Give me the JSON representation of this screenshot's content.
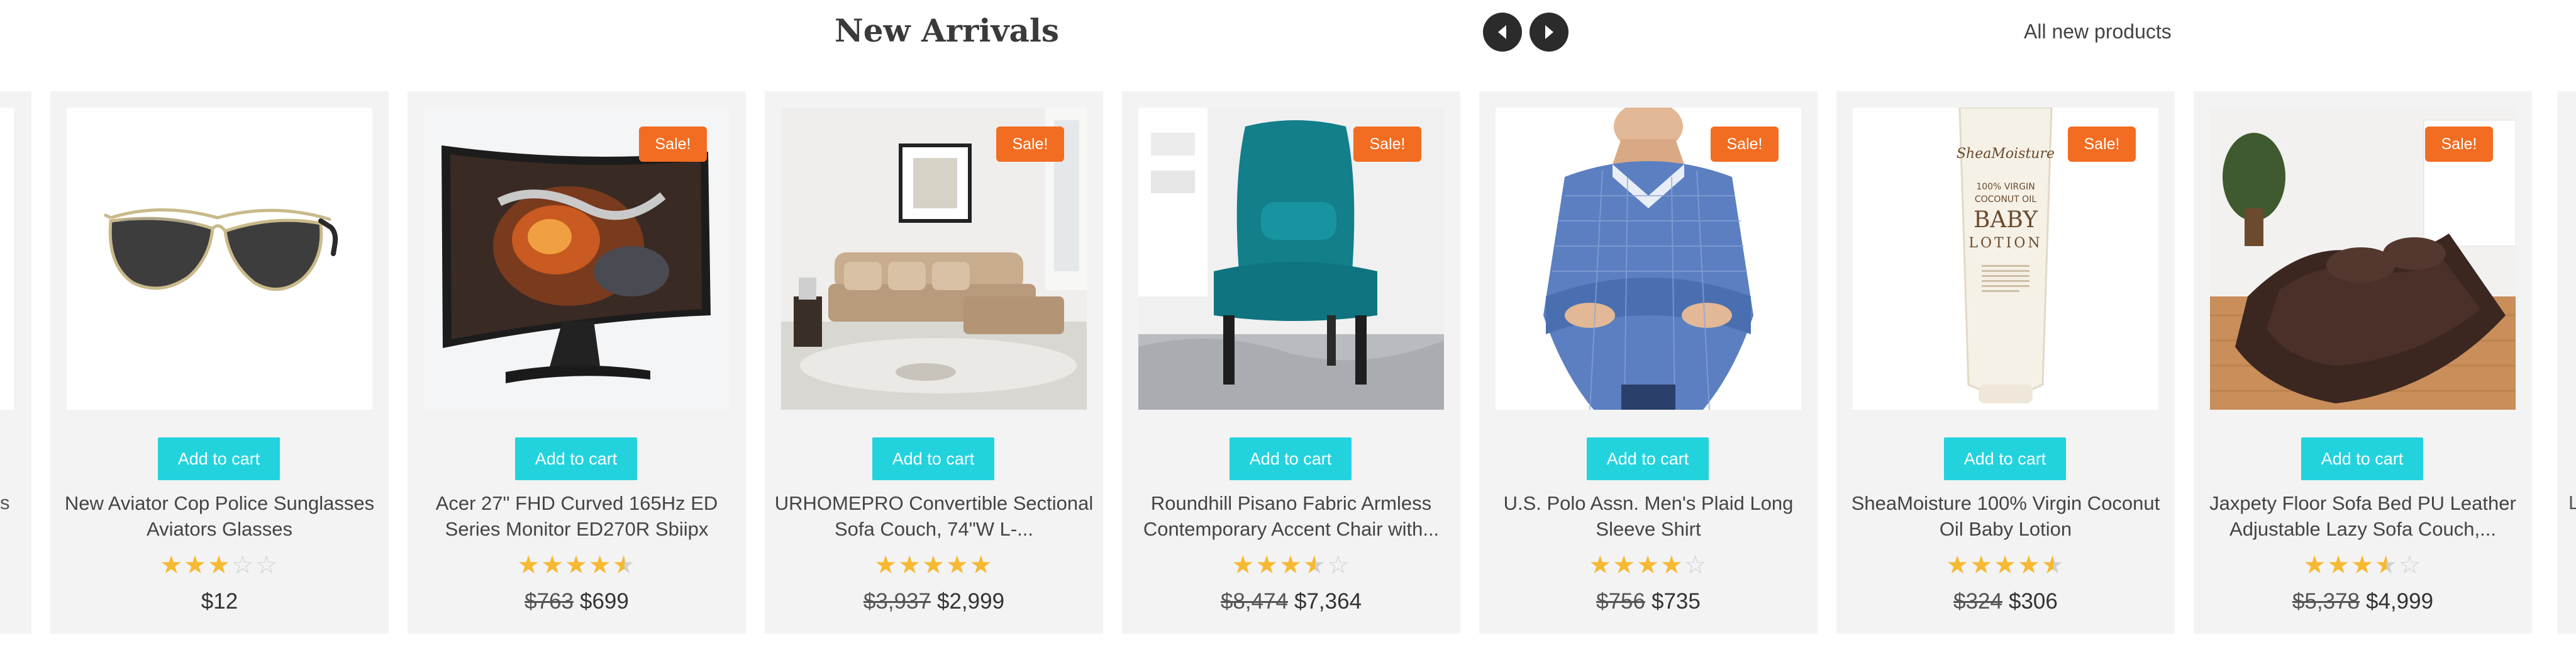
{
  "header": {
    "title": "New Arrivals",
    "all_link": "All new products",
    "prev_icon": "chevron-left-icon",
    "next_icon": "chevron-right-icon",
    "nav_color": "#2b2b2b"
  },
  "colors": {
    "card_bg": "#f3f3f3",
    "cart_button": "#22d3de",
    "sale_badge": "#f26d21",
    "star": "#f6b931"
  },
  "partial_left": {
    "text": "s"
  },
  "partial_right": {
    "text": "L"
  },
  "products": [
    {
      "title": "New Aviator Cop Police Sunglasses Aviators Glasses",
      "cart_label": "Add to cart",
      "sale": false,
      "rating": 3,
      "old_price": "",
      "price": "$12",
      "image": "sunglasses"
    },
    {
      "title": "Acer 27\" FHD Curved 165Hz ED Series Monitor ED270R Sbiipx",
      "cart_label": "Add to cart",
      "sale": true,
      "sale_label": "Sale!",
      "rating": 4.5,
      "old_price": "$763",
      "price": "$699",
      "image": "monitor"
    },
    {
      "title": "URHOMEPRO Convertible Sectional Sofa Couch, 74\"W L-...",
      "cart_label": "Add to cart",
      "sale": true,
      "sale_label": "Sale!",
      "rating": 5,
      "old_price": "$3,937",
      "price": "$2,999",
      "image": "sofa"
    },
    {
      "title": "Roundhill Pisano Fabric Armless Contemporary Accent Chair with...",
      "cart_label": "Add to cart",
      "sale": true,
      "sale_label": "Sale!",
      "rating": 3.5,
      "old_price": "$8,474",
      "price": "$7,364",
      "image": "chair"
    },
    {
      "title": "U.S. Polo Assn. Men's Plaid Long Sleeve Shirt",
      "cart_label": "Add to cart",
      "sale": true,
      "sale_label": "Sale!",
      "rating": 4,
      "old_price": "$756",
      "price": "$735",
      "image": "shirt"
    },
    {
      "title": "SheaMoisture 100% Virgin Coconut Oil Baby Lotion",
      "cart_label": "Add to cart",
      "sale": true,
      "sale_label": "Sale!",
      "rating": 4.5,
      "old_price": "$324",
      "price": "$306",
      "image": "lotion",
      "image_text": [
        "SheaMoisture",
        "100% VIRGIN",
        "COCONUT OIL",
        "BABY",
        "LOTION"
      ]
    },
    {
      "title": "Jaxpety Floor Sofa Bed PU Leather Adjustable Lazy Sofa Couch,...",
      "cart_label": "Add to cart",
      "sale": true,
      "sale_label": "Sale!",
      "rating": 3.5,
      "old_price": "$5,378",
      "price": "$4,999",
      "image": "floor-sofa"
    }
  ]
}
